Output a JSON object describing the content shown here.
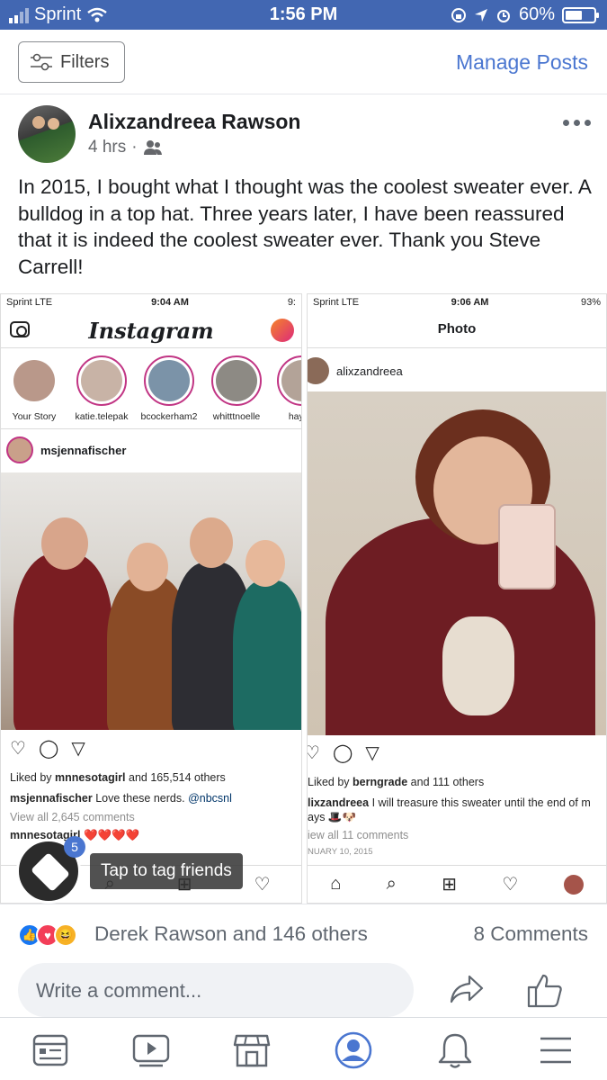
{
  "status_bar": {
    "carrier": "Sprint",
    "time": "1:56 PM",
    "battery": "60%",
    "battery_level": 0.6
  },
  "toolbar": {
    "filters_label": "Filters",
    "manage_label": "Manage Posts"
  },
  "post": {
    "author": "Alixzandreea Rawson",
    "time": "4 hrs",
    "privacy_icon": "friends-icon",
    "text": "In 2015, I bought what I thought was the coolest sweater ever. A bulldog in a top hat. Three years later, I have been reassured that it is indeed the coolest sweater ever. Thank you Steve Carrell!"
  },
  "screenshot_left": {
    "status_carrier": "Sprint  LTE",
    "status_time": "9:04 AM",
    "status_right": "9:",
    "app_title": "Instagram",
    "stories": [
      {
        "name": "Your Story"
      },
      {
        "name": "katie.telepak"
      },
      {
        "name": "bcockerham2"
      },
      {
        "name": "whitttnoelle"
      },
      {
        "name": "hayley"
      }
    ],
    "post_user": "msjennafischer",
    "liked_by_prefix": "Liked by",
    "liked_by_user": "mnnesotagirl",
    "liked_by_suffix": "and 165,514 others",
    "caption_user": "msjennafischer",
    "caption": "Love these nerds.",
    "caption_tag": "@nbcsnl",
    "view_comments": "View all 2,645 comments",
    "comment_user": "mnnesotagirl",
    "comment_text": "❤️❤️❤️❤️"
  },
  "screenshot_right": {
    "status_carrier": "Sprint  LTE",
    "status_time": "9:06 AM",
    "status_right": "93%",
    "title": "Photo",
    "post_user": "alixzandreea",
    "liked_by_prefix": "Liked by",
    "liked_by_user": "berngrade",
    "liked_by_suffix": "and 111 others",
    "caption_user": "lixzandreea",
    "caption": "I will treasure this sweater until the end of m",
    "caption_cont": "ays 🎩🐶",
    "view_comments": "iew all 11 comments",
    "date": "NUARY 10, 2015"
  },
  "tag_hint": {
    "count": "5",
    "label": "Tap to tag friends"
  },
  "reactions": {
    "names": "Derek Rawson and 146 others",
    "comments": "8 Comments"
  },
  "comment_box": {
    "placeholder": "Write a comment..."
  },
  "bottom_nav": [
    {
      "name": "news-feed-icon"
    },
    {
      "name": "watch-icon"
    },
    {
      "name": "marketplace-icon"
    },
    {
      "name": "profile-icon"
    },
    {
      "name": "notifications-icon"
    },
    {
      "name": "menu-icon"
    }
  ],
  "colors": {
    "status_bar": "#4267b2",
    "link_blue": "#4a76d0",
    "active_nav": "#4a76d0"
  }
}
